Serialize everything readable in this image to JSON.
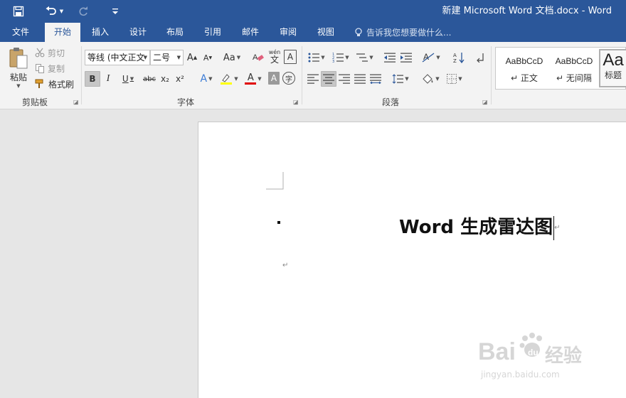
{
  "window": {
    "title": "新建 Microsoft Word 文档.docx - Word"
  },
  "qat": {
    "save_icon": "save-icon",
    "undo_icon": "undo-icon",
    "redo_icon": "redo-icon",
    "customize_icon": "customize-qat-icon"
  },
  "tabs": [
    "文件",
    "开始",
    "插入",
    "设计",
    "布局",
    "引用",
    "邮件",
    "审阅",
    "视图"
  ],
  "active_tab": "开始",
  "tell_me": {
    "placeholder": "告诉我您想要做什么..."
  },
  "clipboard": {
    "paste": "粘贴",
    "cut": "剪切",
    "copy": "复制",
    "format_painter": "格式刷",
    "group": "剪贴板"
  },
  "font": {
    "family": "等线 (中文正文",
    "size": "二号",
    "grow": "A",
    "shrink": "A",
    "change_case": "Aa",
    "phonetic": "wén",
    "phonetic_char": "文",
    "border_char": "A",
    "bold": "B",
    "italic": "I",
    "underline": "U",
    "strikethrough": "abc",
    "subscript": "x₂",
    "superscript": "x²",
    "text_effects": "A",
    "font_color": "A",
    "shading": "A",
    "enclose": "字",
    "group": "字体",
    "highlight_color": "#ffff00",
    "font_color_value": "#e00000"
  },
  "paragraph": {
    "group": "段落"
  },
  "styles": {
    "items": [
      {
        "sample": "AaBbCcD",
        "name": "正文"
      },
      {
        "sample": "AaBbCcD",
        "name": "无间隔"
      },
      {
        "sample": "Aa",
        "name": "标题"
      }
    ]
  },
  "document": {
    "heading": "Word 生成雷达图"
  },
  "watermark": {
    "brand": "Bai",
    "brand2": "du",
    "brand_cn": "经验",
    "url": "jingyan.baidu.com"
  },
  "colors": {
    "accent": "#2b579a"
  }
}
